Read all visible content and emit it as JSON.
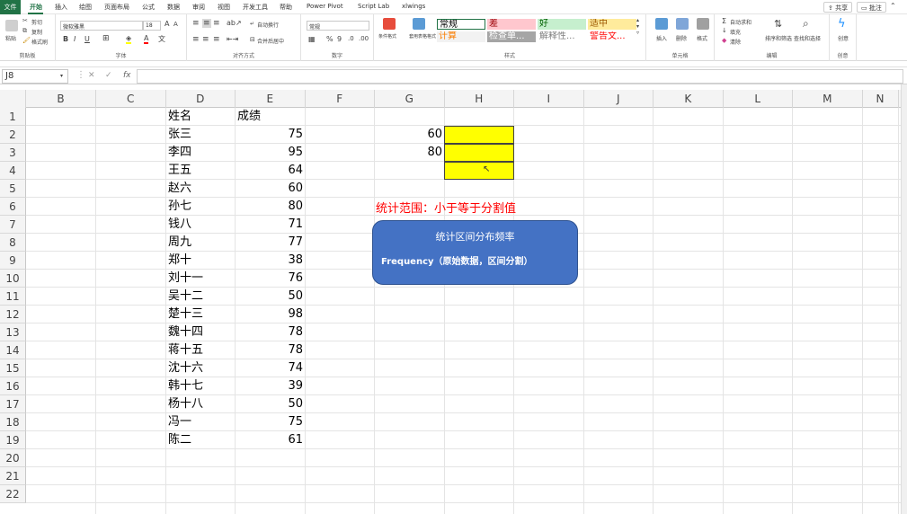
{
  "menu": {
    "tabs": [
      "文件",
      "开始",
      "插入",
      "绘图",
      "页面布局",
      "公式",
      "数据",
      "审阅",
      "视图",
      "开发工具",
      "帮助",
      "Power Pivot",
      "Script Lab",
      "xlwings"
    ],
    "share": "共享",
    "comments": "批注"
  },
  "ribbon": {
    "clipboard": {
      "label": "剪贴板",
      "paste": "粘贴",
      "cut": "剪切",
      "copy": "复制",
      "format_painter": "格式刷"
    },
    "font": {
      "label": "字体",
      "name": "微软雅黑",
      "size": "18",
      "bold": "B",
      "italic": "I",
      "underline": "U"
    },
    "alignment": {
      "label": "对齐方式",
      "wrap": "自动换行",
      "merge": "合并后居中"
    },
    "number": {
      "label": "数字",
      "format": "常规"
    },
    "styles": {
      "label": "样式",
      "conditional": "条件格式",
      "table": "套用表格格式",
      "cells": [
        {
          "text": "常规",
          "bg": "#ffffff",
          "fg": "#000000"
        },
        {
          "text": "差",
          "bg": "#ffc7ce",
          "fg": "#9c0006"
        },
        {
          "text": "好",
          "bg": "#c6efce",
          "fg": "#006100"
        },
        {
          "text": "适中",
          "bg": "#ffeb9c",
          "fg": "#9c5700"
        },
        {
          "text": "计算",
          "bg": "#f2f2f2",
          "fg": "#fa7d00"
        },
        {
          "text": "检查单...",
          "bg": "#a5a5a5",
          "fg": "#ffffff"
        },
        {
          "text": "解释性...",
          "bg": "#ffffff",
          "fg": "#7f7f7f"
        },
        {
          "text": "警告文...",
          "bg": "#ffffff",
          "fg": "#ff0000"
        }
      ]
    },
    "cells_group": {
      "label": "单元格",
      "insert": "插入",
      "delete": "删除",
      "format": "格式"
    },
    "editing": {
      "label": "编辑",
      "autosum": "自动求和",
      "fill": "填充",
      "clear": "清除",
      "sort": "排序和筛选",
      "find": "查找和选择"
    },
    "ideas": {
      "label": "创意",
      "button": "创意"
    }
  },
  "formula_bar": {
    "name_box": "J8",
    "fx": "fx",
    "value": ""
  },
  "columns": [
    "B",
    "C",
    "D",
    "E",
    "F",
    "G",
    "H",
    "I",
    "J",
    "K",
    "L",
    "M",
    "N"
  ],
  "rows": [
    "1",
    "2",
    "3",
    "4",
    "5",
    "6",
    "7",
    "8",
    "9",
    "10",
    "11",
    "12",
    "13",
    "14",
    "15",
    "16",
    "17",
    "18",
    "19",
    "20",
    "21",
    "22"
  ],
  "sheet": {
    "header_name": "姓名",
    "header_score": "成绩",
    "records": [
      {
        "name": "张三",
        "score": "75"
      },
      {
        "name": "李四",
        "score": "95"
      },
      {
        "name": "王五",
        "score": "64"
      },
      {
        "name": "赵六",
        "score": "60"
      },
      {
        "name": "孙七",
        "score": "80"
      },
      {
        "name": "钱八",
        "score": "71"
      },
      {
        "name": "周九",
        "score": "77"
      },
      {
        "name": "郑十",
        "score": "38"
      },
      {
        "name": "刘十一",
        "score": "76"
      },
      {
        "name": "吴十二",
        "score": "50"
      },
      {
        "name": "楚十三",
        "score": "98"
      },
      {
        "name": "魏十四",
        "score": "78"
      },
      {
        "name": "蒋十五",
        "score": "78"
      },
      {
        "name": "沈十六",
        "score": "74"
      },
      {
        "name": "韩十七",
        "score": "39"
      },
      {
        "name": "杨十八",
        "score": "50"
      },
      {
        "name": "冯一",
        "score": "75"
      },
      {
        "name": "陈二",
        "score": "61"
      }
    ],
    "bin1": "60",
    "bin2": "80",
    "highlight_color": "#ffff00"
  },
  "note": "统计范围：小于等于分割值",
  "callout": {
    "title": "统计区间分布频率",
    "desc": "Frequency（原始数据，区间分割）",
    "color": "#4472c4"
  }
}
